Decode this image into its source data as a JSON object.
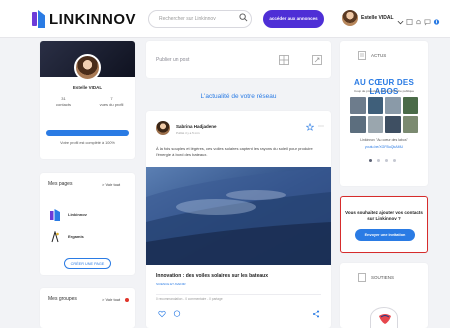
{
  "app": {
    "logo_text": "LINKINNOV"
  },
  "header": {
    "search_placeholder": "Rechercher sur Linkinnov",
    "cta_label": "accéder aux annonces",
    "user_name": "Estelle VIDAL"
  },
  "profile": {
    "name": "Estelle VIDAL",
    "contacts_count": "31",
    "contacts_label": "contacts",
    "views_count": "7",
    "views_label": "vues du profil",
    "completion_percent": 100,
    "completion_text": "Votre profil est complété à 100%"
  },
  "pages": {
    "title": "Mes pages",
    "see_all": "> Voir tout",
    "items": [
      {
        "label": "Linkinnov"
      },
      {
        "label": "Ergamis"
      }
    ],
    "create_label": "CRÉER UNE PAGE"
  },
  "groups": {
    "title": "Mes groupes",
    "see_all": "> Voir tout"
  },
  "composer": {
    "placeholder": "Publier un post"
  },
  "feed": {
    "heading": "L'actualité de votre réseau"
  },
  "post": {
    "author": "Sabrina Hadjadene",
    "meta": "Publié il y a 5 min",
    "text": "À la fois souples et légères, ces voiles solaires captent les rayons du soleil pour produire l'énergie à bord des bateaux.",
    "title": "Innovation : des voiles solaires sur les bateaux",
    "subtitle": "SCIENCE ET AVENIR",
    "stats": "0 recommandation - 0 commentaire - 0 partage"
  },
  "actus": {
    "title": "ACTUS",
    "magazine_title": "AU CŒUR DES LABOS",
    "magazine_subtitle": "Coup de projecteur sur la recherche publique",
    "caption": "Linkinnov \"Au cœur des labos\"",
    "link": "youtu.be/XGFBuQkAMU"
  },
  "invite": {
    "text": "Vous souhaitez ajouter vos contacts sur Linkinnov ?",
    "button_label": "Envoyer une invitation"
  },
  "soutiens": {
    "title": "SOUTIENS"
  },
  "icons": {
    "search": "search-icon",
    "bell": "bell-icon",
    "chat": "chat-icon",
    "image": "image-icon",
    "link": "link-icon",
    "star": "star-icon",
    "heart": "heart-icon",
    "comment": "comment-icon",
    "share": "share-icon"
  },
  "colors": {
    "brand_blue": "#2a7be4",
    "cta_purple": "#4e2fd6",
    "alert_red": "#d62c2c"
  }
}
